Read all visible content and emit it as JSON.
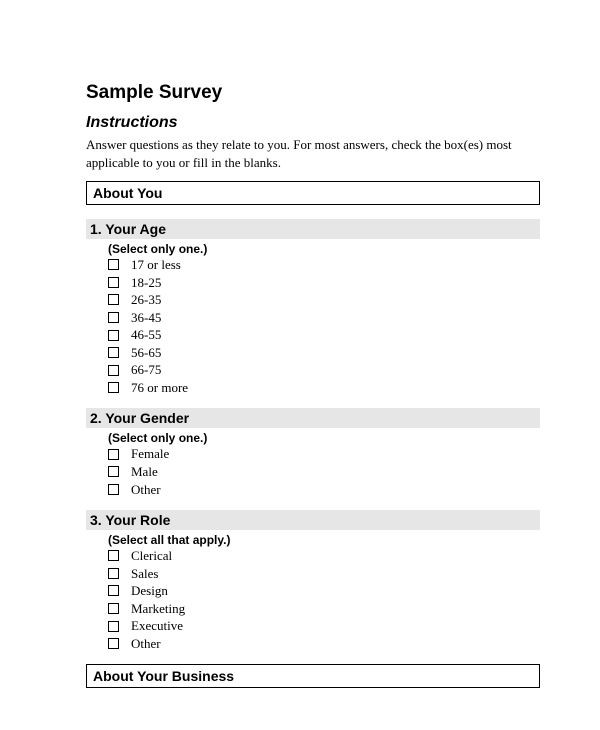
{
  "title": "Sample Survey",
  "instructions": {
    "heading": "Instructions",
    "text": "Answer questions as they relate to you. For most answers, check the box(es) most applicable to you or fill in the blanks."
  },
  "sections": {
    "aboutYou": "About You",
    "aboutBusiness": "About Your Business"
  },
  "questions": {
    "q1": {
      "title": "1. Your Age",
      "hint": "(Select only one.)",
      "options": [
        "17 or less",
        "18-25",
        "26-35",
        "36-45",
        "46-55",
        "56-65",
        "66-75",
        "76 or more"
      ]
    },
    "q2": {
      "title": "2. Your Gender",
      "hint": "(Select only one.)",
      "options": [
        "Female",
        "Male",
        "Other"
      ]
    },
    "q3": {
      "title": "3. Your Role",
      "hint": "(Select all that apply.)",
      "options": [
        "Clerical",
        "Sales",
        "Design",
        "Marketing",
        "Executive",
        "Other"
      ]
    }
  }
}
